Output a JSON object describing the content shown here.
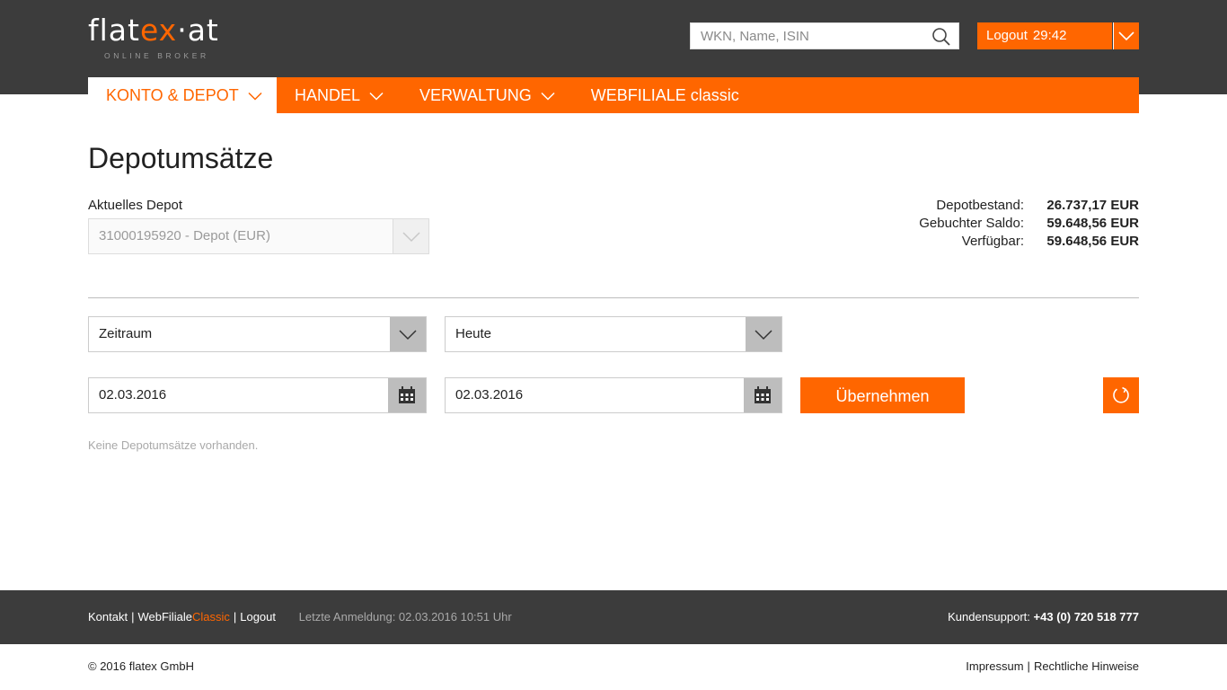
{
  "brand": {
    "logo_text_a": "flat",
    "logo_text_ex": "ex",
    "logo_text_b": "·at",
    "tagline": "ONLINE BROKER",
    "accent_color": "#ff6600",
    "header_color": "#3c3c3c"
  },
  "header": {
    "search_placeholder": "WKN, Name, ISIN",
    "search_icon": "search-icon",
    "logout_label": "Logout",
    "session_timer": "29:42"
  },
  "nav": {
    "items": [
      {
        "label": "KONTO & DEPOT",
        "active": true
      },
      {
        "label": "HANDEL",
        "active": false
      },
      {
        "label": "VERWALTUNG",
        "active": false
      },
      {
        "label": "WEBFILIALE classic",
        "active": false
      }
    ]
  },
  "page": {
    "title": "Depotumsätze",
    "depot_label": "Aktuelles Depot",
    "depot_value": "31000195920 - Depot (EUR)"
  },
  "summary": {
    "rows": [
      {
        "label": "Depotbestand:",
        "value": "26.737,17 EUR"
      },
      {
        "label": "Gebuchter Saldo:",
        "value": "59.648,56 EUR"
      },
      {
        "label": "Verfügbar:",
        "value": "59.648,56 EUR"
      }
    ]
  },
  "filters": {
    "period_type": "Zeitraum",
    "period_value": "Heute",
    "date_from": "02.03.2016",
    "date_to": "02.03.2016",
    "apply_label": "Übernehmen",
    "empty_message": "Keine Depotumsätze vorhanden."
  },
  "footer": {
    "link_contact": "Kontakt",
    "link_webfiliale": "WebFiliale",
    "link_webfiliale_suffix": "Classic",
    "link_logout": "Logout",
    "last_login": "Letzte Anmeldung: 02.03.2016 10:51 Uhr",
    "support_label": "Kundensupport:",
    "support_phone": "+43 (0) 720 518 777",
    "copyright": "© 2016 flatex GmbH",
    "link_impressum": "Impressum",
    "link_legal": "Rechtliche Hinweise"
  }
}
